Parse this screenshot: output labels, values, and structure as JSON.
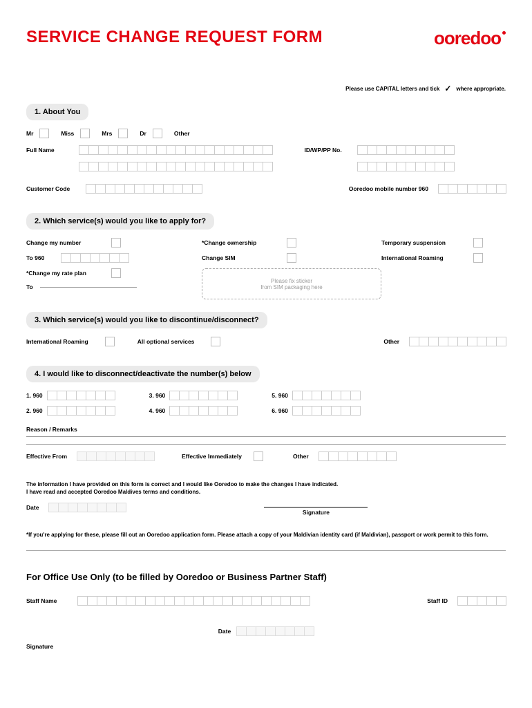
{
  "title": "SERVICE CHANGE REQUEST FORM",
  "logo": "ooredoo",
  "instruction_pre": "Please use CAPITAL letters and tick",
  "instruction_post": "where appropriate.",
  "section1": {
    "header": "1. About You",
    "titles": {
      "mr": "Mr",
      "miss": "Miss",
      "mrs": "Mrs",
      "dr": "Dr",
      "other": "Other"
    },
    "full_name": "Full Name",
    "id_no": "ID/WP/PP No.",
    "customer_code": "Customer Code",
    "mobile": "Ooredoo mobile number 960"
  },
  "section2": {
    "header": "2. Which service(s) would you like to apply for?",
    "change_number": "Change my number",
    "to_960": "To 960",
    "change_plan": "*Change my rate plan",
    "to": "To",
    "change_ownership": "*Change ownership",
    "change_sim": "Change SIM",
    "temp_suspension": "Temporary suspension",
    "intl_roaming": "International Roaming",
    "sticker1": "Please fix sticker",
    "sticker2": "from SIM packaging here"
  },
  "section3": {
    "header": "3. Which service(s) would you like to discontinue/disconnect?",
    "intl_roaming": "International Roaming",
    "all_optional": "All optional services",
    "other": "Other"
  },
  "section4": {
    "header": "4. I would like to disconnect/deactivate the number(s) below",
    "n1": "1. 960",
    "n2": "2. 960",
    "n3": "3. 960",
    "n4": "4. 960",
    "n5": "5. 960",
    "n6": "6. 960",
    "reason": "Reason / Remarks",
    "effective_from": "Effective From",
    "effective_immediately": "Effective Immediately",
    "other": "Other"
  },
  "declaration": {
    "line1": "The information I have provided on this form is correct and I would like Ooredoo to make the changes I have indicated.",
    "line2": "I have read and accepted Ooredoo Maldives terms and conditions.",
    "date": "Date",
    "signature": "Signature"
  },
  "footnote": "*If you're applying for these, please fill out an Ooredoo application form. Please attach a copy of your Maldivian identity card (if Maldivian), passport or work permit to this form.",
  "office": {
    "header": "For Office Use Only (to be filled by Ooredoo or Business Partner Staff)",
    "staff_name": "Staff Name",
    "staff_id": "Staff ID",
    "date": "Date",
    "signature": "Signature"
  }
}
